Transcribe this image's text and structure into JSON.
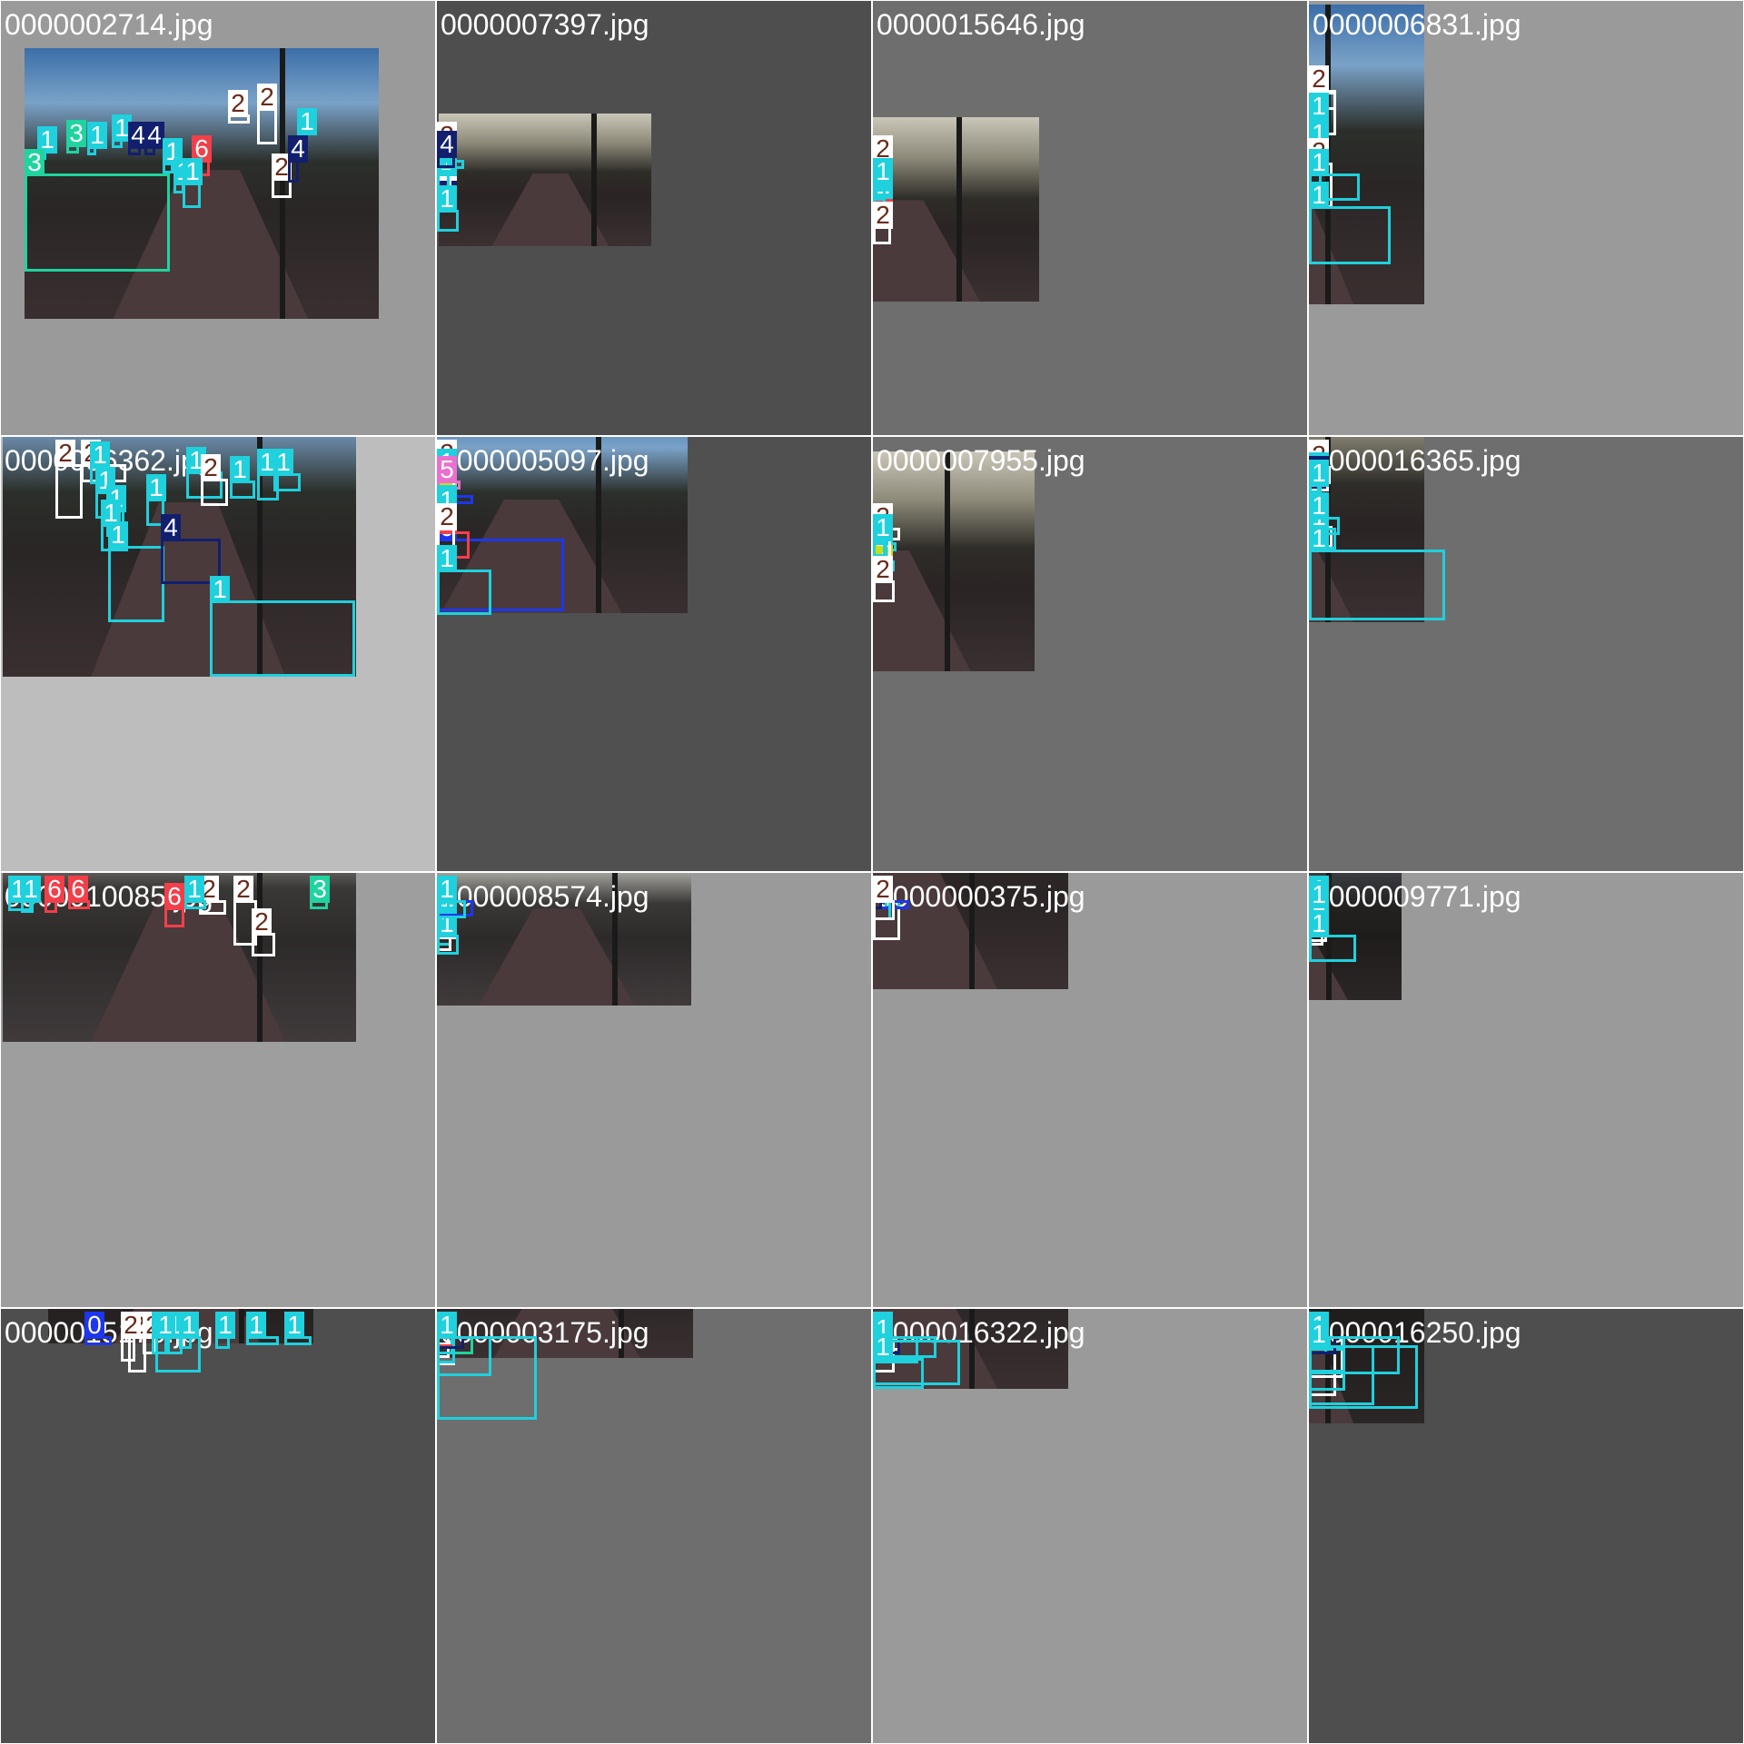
{
  "mosaic": {
    "tiles": [
      {
        "name": "0000002714.jpg",
        "bg": "#9a9a9a",
        "photo_style": "blue",
        "labels": [
          "1",
          "3",
          "1",
          "1",
          "4",
          "4",
          "1",
          "6",
          "1",
          "3",
          "2",
          "2",
          "1",
          "2",
          "4",
          "1"
        ]
      },
      {
        "name": "0000007397.jpg",
        "bg": "#4e4e4e",
        "photo_style": "dusk",
        "labels": [
          "2",
          "2",
          "4",
          "2",
          "1",
          "1",
          "1",
          "1",
          "4",
          "1"
        ]
      },
      {
        "name": "0000015646.jpg",
        "bg": "#6e6e6e",
        "photo_style": "dusk",
        "labels": [
          "3",
          "1",
          "1",
          "1",
          "1",
          "2",
          "2",
          "6",
          "1",
          "1",
          "1",
          "2"
        ]
      },
      {
        "name": "0000006831.jpg",
        "bg": "#9a9a9a",
        "photo_style": "blue",
        "labels": [
          "1",
          "1",
          "1",
          "1",
          "4",
          "2",
          "2",
          "1",
          "1",
          "1",
          "1",
          "1",
          "1",
          "2",
          "1",
          "1"
        ]
      },
      {
        "name": "0000006362.jpg",
        "bg": "#bdbdbd",
        "photo_style": "blue",
        "labels": [
          "2",
          "2",
          "1",
          "1",
          "1",
          "1",
          "1",
          "1",
          "4",
          "1",
          "2",
          "1",
          "1",
          "1",
          "1"
        ]
      },
      {
        "name": "0000005097.jpg",
        "bg": "#505050",
        "photo_style": "blue",
        "labels": [
          "1",
          "0",
          "1",
          "1",
          "7",
          "2",
          "2",
          "1",
          "5",
          "0",
          "6",
          "1",
          "1",
          "1",
          "2",
          "1"
        ]
      },
      {
        "name": "0000007955.jpg",
        "bg": "#6e6e6e",
        "photo_style": "dusk",
        "labels": [
          "1",
          "1",
          "1",
          "1",
          "4",
          "4",
          "1",
          "7",
          "1",
          "2",
          "2",
          "1",
          "2"
        ]
      },
      {
        "name": "0000016365.jpg",
        "bg": "#6e6e6e",
        "photo_style": "dusk",
        "labels": [
          "1",
          "1",
          "4",
          "2",
          "2",
          "1",
          "1",
          "4",
          "4",
          "4",
          "1",
          "1",
          "2",
          "1",
          "1",
          "1"
        ]
      },
      {
        "name": "0000010085.jpg",
        "bg": "#9e9e9e",
        "photo_style": "grey",
        "labels": [
          "1",
          "1",
          "6",
          "6",
          "6",
          "2",
          "2",
          "1",
          "3",
          "2"
        ]
      },
      {
        "name": "0000008574.jpg",
        "bg": "#9a9a9a",
        "photo_style": "grey",
        "labels": [
          "0",
          "4",
          "3",
          "1",
          "2",
          "2",
          "1",
          "2",
          "1",
          "0",
          "1",
          "1"
        ]
      },
      {
        "name": "0000000375.jpg",
        "bg": "#9a9a9a",
        "photo_style": "dusk",
        "labels": [
          "2",
          "2",
          "1",
          "1",
          "0",
          "4",
          "1",
          "2"
        ]
      },
      {
        "name": "0000009771.jpg",
        "bg": "#9a9a9a",
        "photo_style": "dark",
        "labels": [
          "2",
          "2",
          "1",
          "2",
          "3",
          "1",
          "1",
          "1",
          "1",
          "1",
          "1"
        ]
      },
      {
        "name": "0000015170.jpg",
        "bg": "#4e4e4e",
        "photo_style": "dark",
        "labels": [
          "0",
          "2",
          "2",
          "2",
          "1",
          "1",
          "1",
          "1",
          "1",
          "1",
          "1"
        ]
      },
      {
        "name": "0000003175.jpg",
        "bg": "#6e6e6e",
        "photo_style": "blue",
        "labels": [
          "2",
          "2",
          "2",
          "3",
          "1",
          "7",
          "6",
          "1",
          "1",
          "4",
          "1",
          "1"
        ]
      },
      {
        "name": "0000016322.jpg",
        "bg": "#9a9a9a",
        "photo_style": "blue",
        "labels": [
          "2",
          "2",
          "2",
          "4",
          "5",
          "1",
          "4",
          "4",
          "1",
          "1",
          "1",
          "1",
          "1",
          "1"
        ]
      },
      {
        "name": "0000016250.jpg",
        "bg": "#4e4e4e",
        "photo_style": "dark",
        "labels": [
          "2",
          "2",
          "1",
          "1",
          "2",
          "4",
          "1",
          "4",
          "1",
          "1",
          "1",
          "1",
          "1"
        ]
      }
    ]
  },
  "class_colors": {
    "0": "#1d36ee",
    "1": "#1fd0dd",
    "2": "#ffffff",
    "3": "#1fd49e",
    "4": "#111f6e",
    "5": "#ea6fcf",
    "6": "#f23f4a",
    "7": "#cddc12"
  },
  "label_text_colors": {
    "2": "#6a2a1a",
    "default": "#ffffff"
  }
}
